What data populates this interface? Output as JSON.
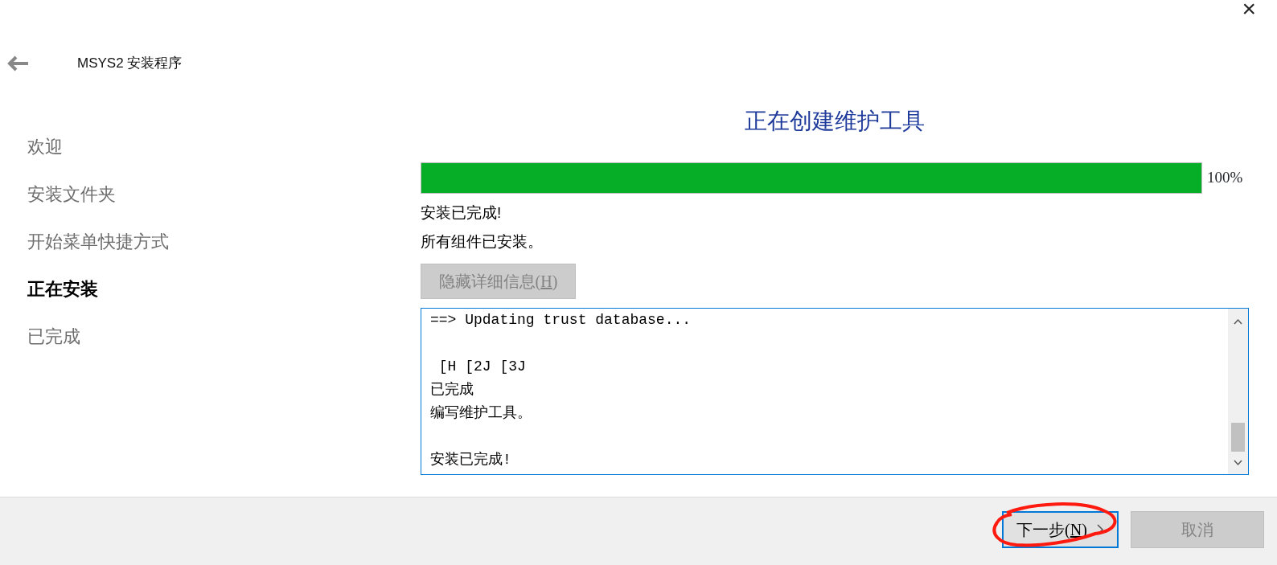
{
  "window": {
    "title": "MSYS2 安装程序",
    "close": "×"
  },
  "steps": [
    {
      "label": "欢迎",
      "selected": false
    },
    {
      "label": "安装文件夹",
      "selected": false
    },
    {
      "label": "开始菜单快捷方式",
      "selected": false
    },
    {
      "label": "正在安装",
      "selected": true
    },
    {
      "label": "已完成",
      "selected": false
    }
  ],
  "page": {
    "title": "正在创建维护工具",
    "progress": {
      "level": 1,
      "reading": "100%"
    },
    "messages": [
      "安装已完成!",
      "所有组件已安装。"
    ],
    "details_button": {
      "label_before": "隐藏详细信息(",
      "accesskey": "H",
      "label_after": ")",
      "disabled": true
    },
    "log": [
      {
        "text": "==> Updating trust database...",
        "gap_before": false
      },
      {
        "text": " [H [2J [3J",
        "gap_before": true
      },
      {
        "text": "已完成",
        "gap_before": false
      },
      {
        "text": "编写维护工具。",
        "gap_before": false
      },
      {
        "text": "安装已完成!",
        "gap_before": true
      }
    ]
  },
  "footer": {
    "buttons": [
      {
        "label_before": "下一步(",
        "accesskey": "N",
        "label_after": ")",
        "disabled": false,
        "focused": true,
        "chevron": true,
        "circled": true
      },
      {
        "label_before": "取消",
        "disabled": true,
        "focused": false,
        "chevron": false,
        "circled": false
      }
    ]
  }
}
